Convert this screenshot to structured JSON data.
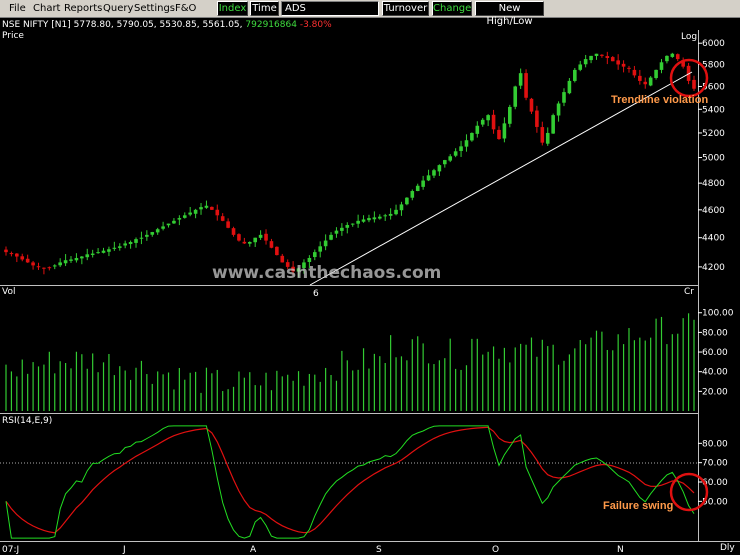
{
  "menu": {
    "items": [
      "File",
      "Chart",
      "Reports",
      "Query",
      "Settings",
      "F&O"
    ],
    "accel": [
      "F",
      "C",
      "R",
      "Q",
      "S",
      ""
    ]
  },
  "toolbar": {
    "index_label": "Index",
    "time_label": "Time",
    "symbol_value": "ADS",
    "turnover_label": "Turnover",
    "change_label": "Change",
    "newhighlow_label": "New High/Low"
  },
  "header": {
    "symbol": "NSE NIFTY [N1]",
    "ohlc": "5778.80, 5790.05, 5530.85, 5561.05,",
    "volume": "792916864",
    "change": "-3.80%"
  },
  "panels": {
    "price_label": "Price",
    "log_label": "Log",
    "vol_label": "Vol",
    "vol_unit": "Cr",
    "rsi_label": "RSI(14,E,9)",
    "period_label": "Dly"
  },
  "annotations": {
    "trendline": "Trendline violation",
    "failure": "Failure swing",
    "watermark": "www.cashthechaos.com"
  },
  "colors": {
    "up": "#33cc33",
    "down": "#e01010",
    "volume": "#33cc33",
    "rsi": "#22dd22",
    "rsi_signal": "#e01010",
    "annotation": "#ff9a4a",
    "circle": "#e01010",
    "trendline": "#ffffff"
  },
  "chart_data": {
    "type": "candlestick",
    "price_axis": {
      "ticks": [
        6000,
        5800,
        5600,
        5400,
        5200,
        5000,
        4800,
        4600,
        4400,
        4200
      ],
      "range": [
        4100,
        6050
      ],
      "scale": "log"
    },
    "volume_axis": {
      "ticks": [
        100,
        80,
        60,
        40,
        20
      ],
      "range": [
        0,
        115
      ]
    },
    "rsi_axis": {
      "ticks": [
        80,
        70,
        60,
        50
      ],
      "range": [
        30,
        90
      ],
      "reference": 70
    },
    "time_labels": [
      "07:J",
      "J",
      "A",
      "S",
      "O",
      "N"
    ],
    "mid_label": "6",
    "close_series_approx": [
      4300,
      4290,
      4270,
      4250,
      4230,
      4210,
      4200,
      4190,
      4195,
      4210,
      4230,
      4245,
      4250,
      4260,
      4270,
      4285,
      4290,
      4300,
      4310,
      4320,
      4330,
      4340,
      4360,
      4370,
      4390,
      4400,
      4420,
      4440,
      4460,
      4480,
      4500,
      4520,
      4540,
      4560,
      4580,
      4600,
      4620,
      4630,
      4600,
      4560,
      4520,
      4470,
      4420,
      4380,
      4360,
      4370,
      4400,
      4420,
      4380,
      4330,
      4280,
      4230,
      4200,
      4170,
      4190,
      4230,
      4260,
      4300,
      4340,
      4380,
      4420,
      4450,
      4470,
      4490,
      4500,
      4520,
      4530,
      4540,
      4545,
      4550,
      4560,
      4570,
      4600,
      4640,
      4690,
      4740,
      4780,
      4820,
      4860,
      4900,
      4940,
      4980,
      5010,
      5050,
      5090,
      5140,
      5200,
      5260,
      5310,
      5350,
      5230,
      5150,
      5280,
      5420,
      5600,
      5720,
      5500,
      5380,
      5250,
      5120,
      5200,
      5350,
      5450,
      5550,
      5650,
      5750,
      5800,
      5850,
      5880,
      5900,
      5880,
      5860,
      5830,
      5800,
      5780,
      5760,
      5700,
      5650,
      5620,
      5680,
      5750,
      5820,
      5880,
      5900,
      5850,
      5780,
      5650,
      5580
    ]
  }
}
